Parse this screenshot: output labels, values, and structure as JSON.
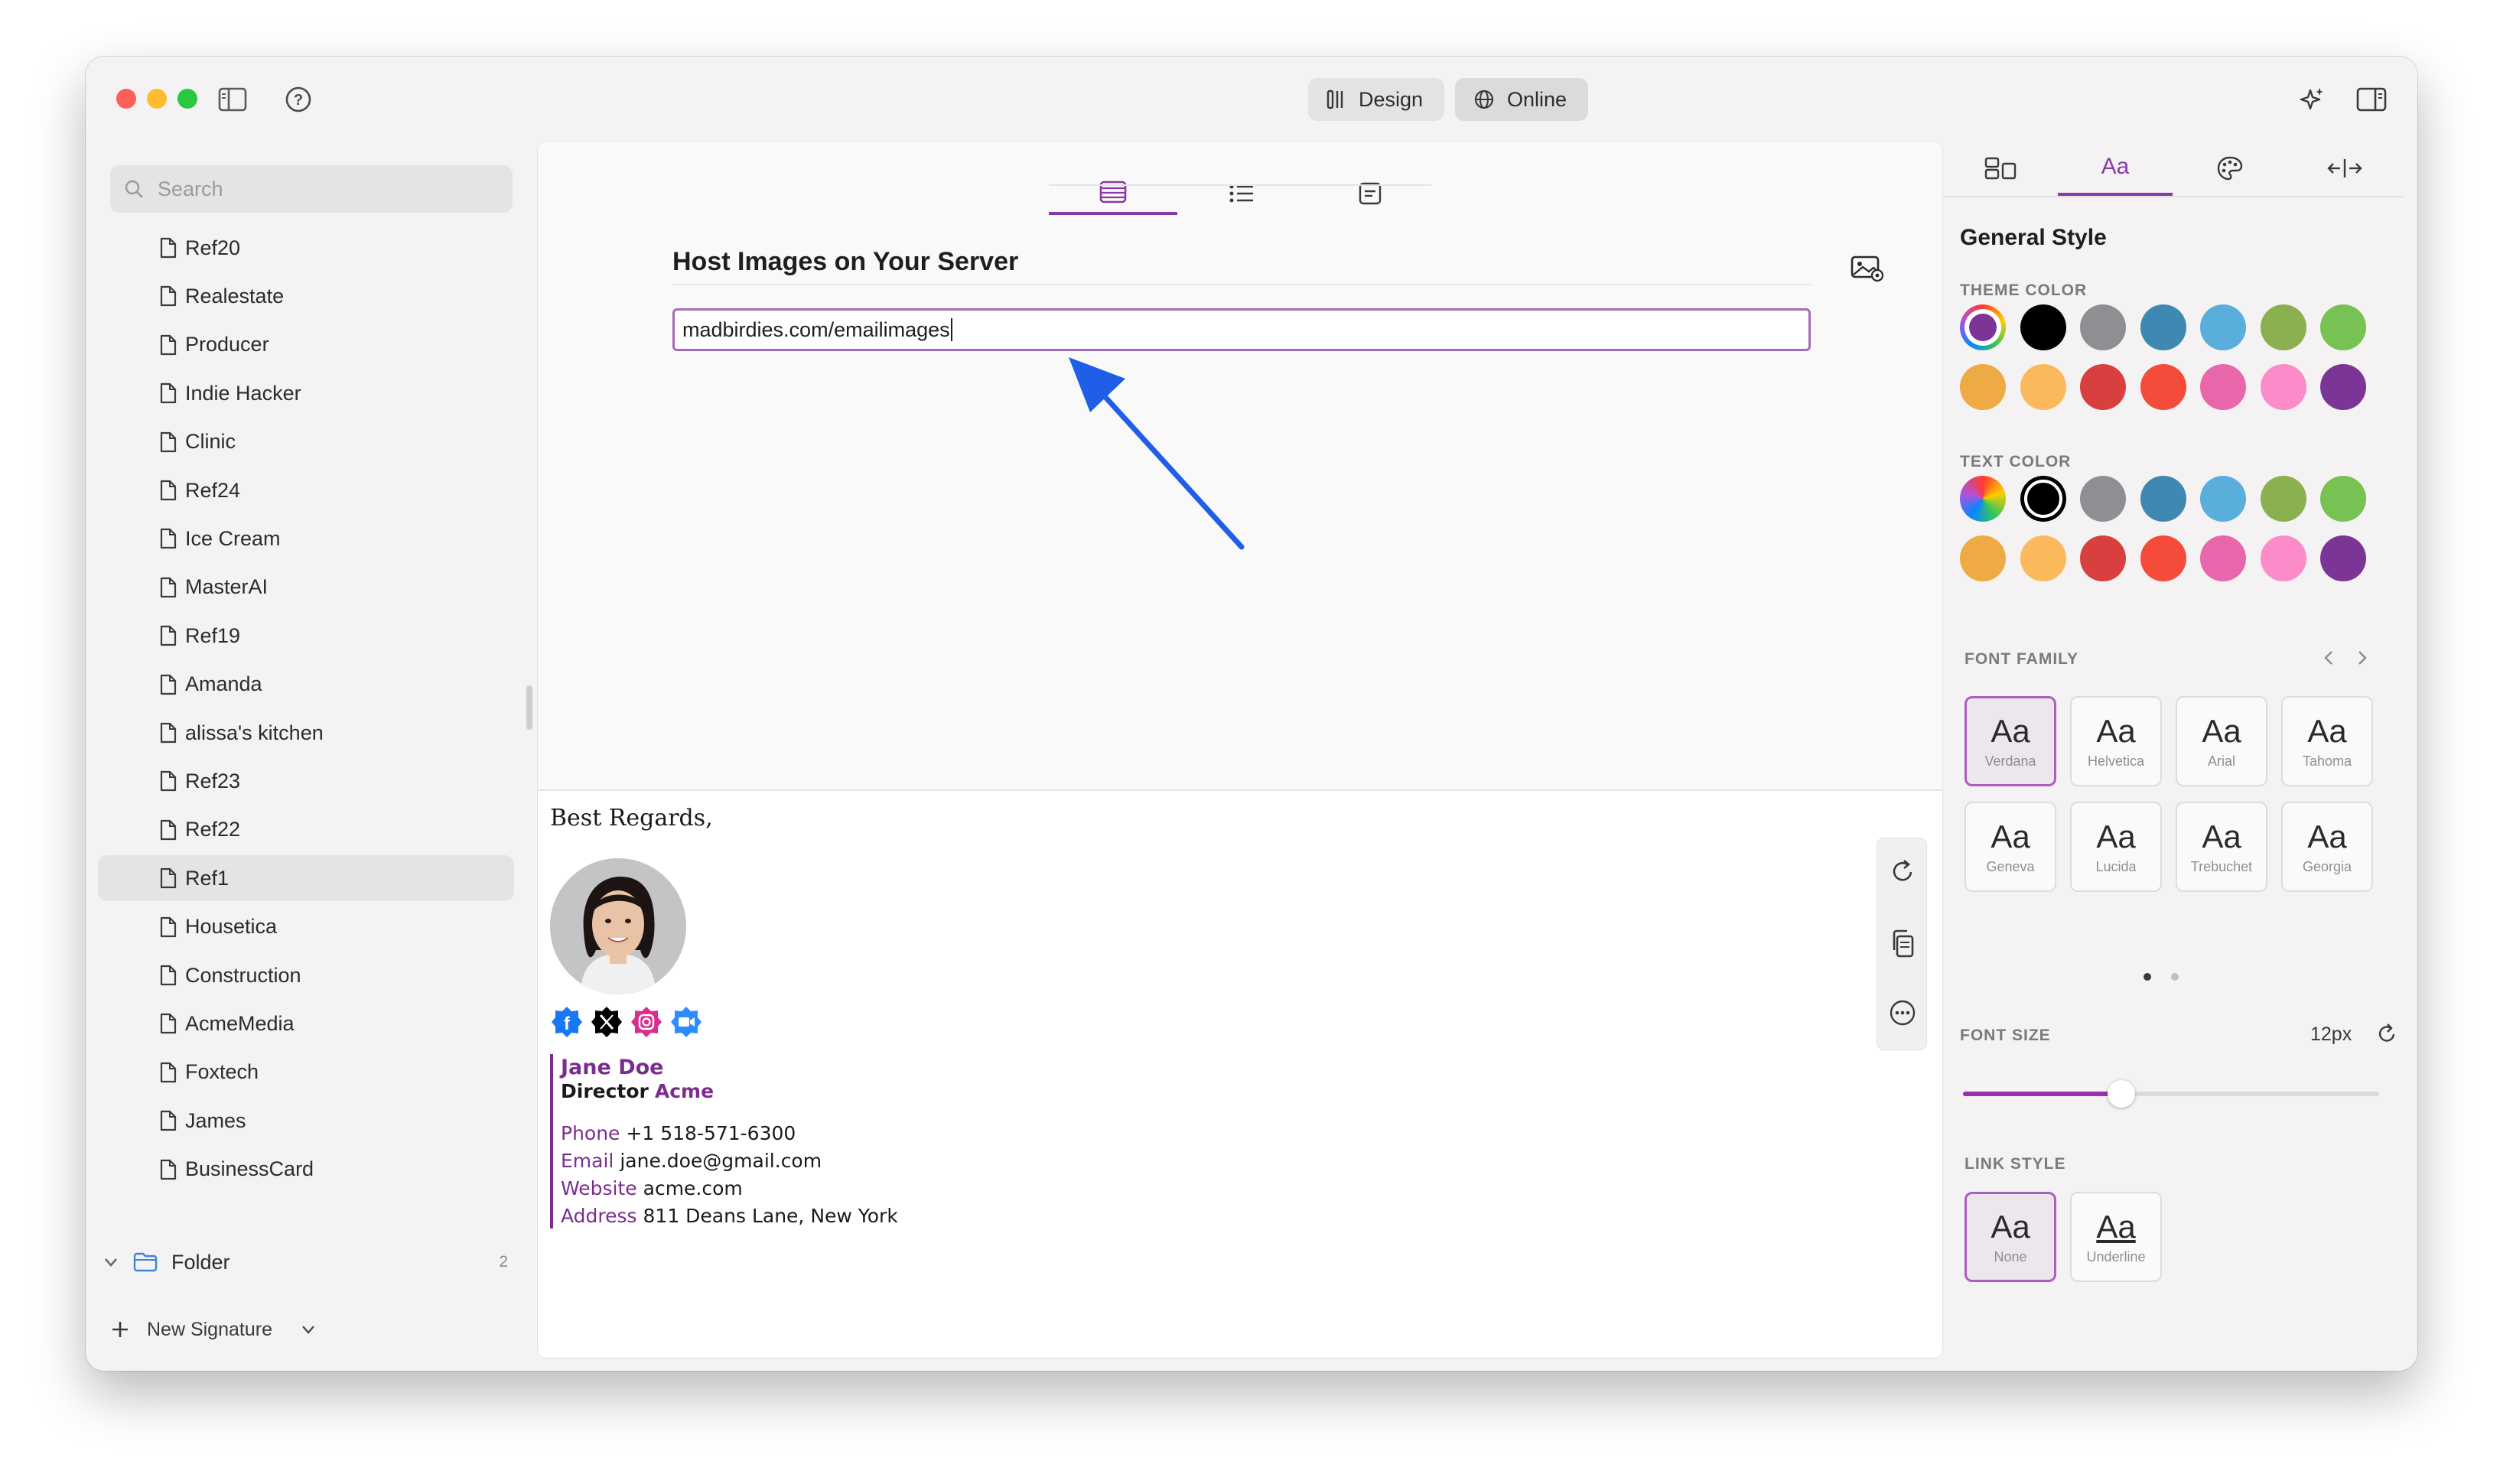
{
  "toolbar": {
    "design_label": "Design",
    "online_label": "Online"
  },
  "sidebar": {
    "search_placeholder": "Search",
    "items": [
      {
        "label": "Ref20"
      },
      {
        "label": "Realestate"
      },
      {
        "label": "Producer"
      },
      {
        "label": "Indie Hacker"
      },
      {
        "label": "Clinic"
      },
      {
        "label": "Ref24"
      },
      {
        "label": "Ice Cream"
      },
      {
        "label": "MasterAI"
      },
      {
        "label": "Ref19"
      },
      {
        "label": "Amanda"
      },
      {
        "label": "alissa's kitchen"
      },
      {
        "label": "Ref23"
      },
      {
        "label": "Ref22"
      },
      {
        "label": "Ref1"
      },
      {
        "label": "Housetica"
      },
      {
        "label": "Construction"
      },
      {
        "label": "AcmeMedia"
      },
      {
        "label": "Foxtech"
      },
      {
        "label": "James"
      },
      {
        "label": "BusinessCard"
      }
    ],
    "selected": "Ref1",
    "folder_label": "Folder",
    "folder_count": "2",
    "new_signature_label": "New Signature"
  },
  "editor": {
    "title": "Host Images on Your Server",
    "url_value": "madbirdies.com/emailimages"
  },
  "signature": {
    "greeting": "Best Regards,",
    "name": "Jane Doe",
    "role": "Director",
    "company": "Acme",
    "phone_label": "Phone",
    "phone": "+1 518-571-6300",
    "email_label": "Email",
    "email": "jane.doe@gmail.com",
    "website_label": "Website",
    "website": "acme.com",
    "address_label": "Address",
    "address": "811 Deans Lane, New York",
    "accent_color": "#7b2d8e"
  },
  "right_panel": {
    "tab_text_label": "Aa",
    "section_title": "General Style",
    "theme_color_label": "THEME COLOR",
    "text_color_label": "TEXT COLOR",
    "colors": [
      "#000000",
      "#8e8e93",
      "#3f88b1",
      "#5aaedb",
      "#8bb04f",
      "#77c253",
      "#eeaa44",
      "#fbb95b",
      "#d83f3f",
      "#f44b3a",
      "#e867aa",
      "#fb8bc9",
      "#7b3596"
    ],
    "font_family_label": "FONT FAMILY",
    "fonts": [
      {
        "sample": "Aa",
        "name": "Verdana"
      },
      {
        "sample": "Aa",
        "name": "Helvetica"
      },
      {
        "sample": "Aa",
        "name": "Arial"
      },
      {
        "sample": "Aa",
        "name": "Tahoma"
      },
      {
        "sample": "Aa",
        "name": "Geneva"
      },
      {
        "sample": "Aa",
        "name": "Lucida"
      },
      {
        "sample": "Aa",
        "name": "Trebuchet"
      },
      {
        "sample": "Aa",
        "name": "Georgia"
      }
    ],
    "selected_font": "Verdana",
    "font_size_label": "FONT SIZE",
    "font_size_value": "12px",
    "font_size_slider_fraction": 0.38,
    "link_style_label": "LINK STYLE",
    "link_styles": [
      {
        "sample": "Aa",
        "name": "None"
      },
      {
        "sample": "Aa",
        "name": "Underline"
      }
    ],
    "selected_link_style": "None"
  }
}
